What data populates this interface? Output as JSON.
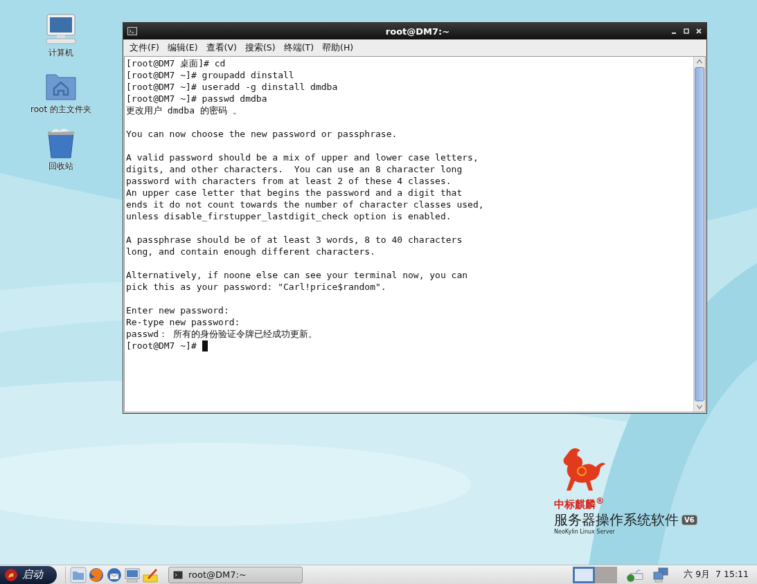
{
  "desktop_icons": [
    {
      "kind": "computer",
      "label": "计算机"
    },
    {
      "kind": "home",
      "label": "root 的主文件夹"
    },
    {
      "kind": "trash",
      "label": "回收站"
    }
  ],
  "window": {
    "title": "root@DM7:~",
    "menu": [
      "文件(F)",
      "编辑(E)",
      "查看(V)",
      "搜索(S)",
      "终端(T)",
      "帮助(H)"
    ],
    "terminal": {
      "paragraphs": [
        {
          "lines": [
            "[root@DM7 桌面]# cd",
            "[root@DM7 ~]# groupadd dinstall",
            "[root@DM7 ~]# useradd -g dinstall dmdba",
            "[root@DM7 ~]# passwd dmdba",
            "更改用户 dmdba 的密码 。"
          ]
        },
        {
          "lines": [
            "You can now choose the new password or passphrase."
          ]
        },
        {
          "lines": [
            "A valid password should be a mix of upper and lower case letters,",
            "digits, and other characters.  You can use an 8 character long",
            "password with characters from at least 2 of these 4 classes.",
            "An upper case letter that begins the password and a digit that",
            "ends it do not count towards the number of character classes used,",
            "unless disable_firstupper_lastdigit_check option is enabled."
          ]
        },
        {
          "lines": [
            "A passphrase should be of at least 3 words, 8 to 40 characters",
            "long, and contain enough different characters."
          ]
        },
        {
          "lines": [
            "Alternatively, if noone else can see your terminal now, you can",
            "pick this as your password: \"Carl!price$random\"."
          ]
        },
        {
          "lines": [
            "Enter new password:",
            "Re-type new password:",
            "passwd： 所有的身份验证令牌已经成功更新。"
          ]
        }
      ],
      "prompt": "[root@DM7 ~]#"
    }
  },
  "branding": {
    "brand": "中标麒麟$^{®}$",
    "product": "服务器操作系统软件",
    "version": "V6",
    "subtitle": "NeoKylin Linux Server"
  },
  "taskbar": {
    "start_label": "启动",
    "launchers": [
      {
        "kind": "folder"
      },
      {
        "kind": "browser"
      },
      {
        "kind": "mail"
      },
      {
        "kind": "monitor"
      },
      {
        "kind": "notes"
      }
    ],
    "tasks": [
      {
        "label": "root@DM7:~"
      }
    ],
    "workspaces": [
      {
        "selected": true
      },
      {
        "selected": false
      }
    ],
    "clock": "六 9月  7 15:11"
  }
}
